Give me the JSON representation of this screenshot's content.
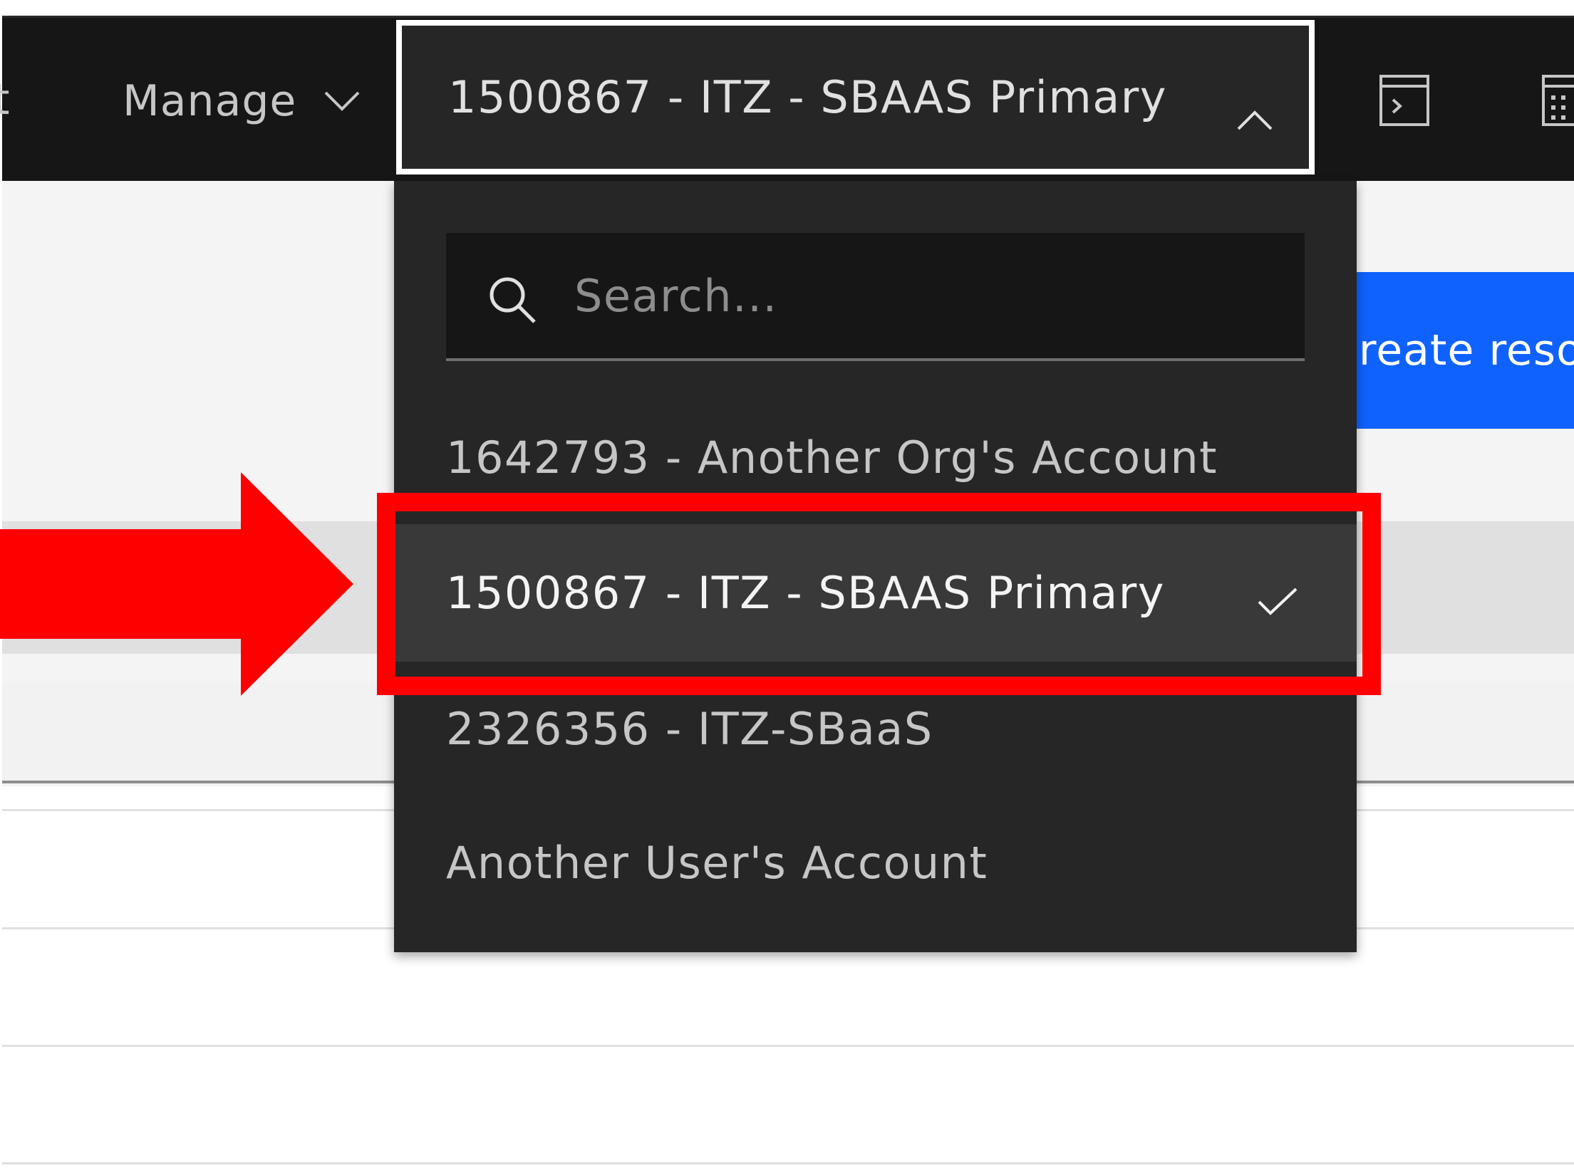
{
  "header": {
    "nav_cut_label": "t",
    "manage_label": "Manage",
    "selected_account": "1500867 - ITZ - SBAAS Primary"
  },
  "account_menu": {
    "search_placeholder": "Search...",
    "options": [
      {
        "label": "1642793 - Another Org's Account",
        "selected": false
      },
      {
        "label": "1500867 - ITZ - SBAAS Primary",
        "selected": true
      },
      {
        "label": "2326356 - ITZ-SBaaS",
        "selected": false
      },
      {
        "label": "Another User's Account",
        "selected": false
      }
    ]
  },
  "page": {
    "create_resource_label": "Create resource"
  },
  "icons": {
    "manage_chevron": "chevron-down-icon",
    "menu_chevron": "chevron-up-icon",
    "header_icon_1": "terminal-icon",
    "header_icon_2": "calculator-icon",
    "search": "search-icon",
    "selected_check": "checkmark-icon"
  },
  "colors": {
    "header_bg": "#161616",
    "menu_bg": "#262626",
    "selected_row_bg": "#393939",
    "primary_button": "#0f62fe",
    "annotation_red": "#ff0000"
  }
}
